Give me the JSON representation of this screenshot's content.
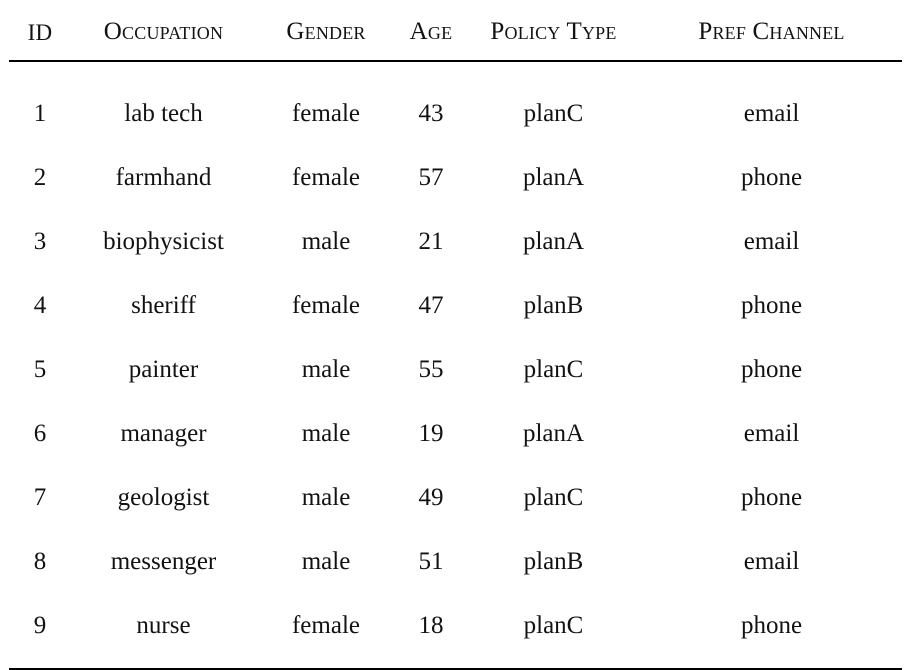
{
  "table": {
    "columns": [
      {
        "key": "id",
        "label": "ID",
        "smallcaps": false
      },
      {
        "key": "occ",
        "label": "Occupation",
        "smallcaps": true
      },
      {
        "key": "gender",
        "label": "Gender",
        "smallcaps": true
      },
      {
        "key": "age",
        "label": "Age",
        "smallcaps": true
      },
      {
        "key": "policy",
        "label": "Policy Type",
        "smallcaps": true
      },
      {
        "key": "channel",
        "label": "Pref Channel",
        "smallcaps": true
      }
    ],
    "rows": [
      {
        "id": "1",
        "occ": "lab tech",
        "gender": "female",
        "age": "43",
        "policy": "planC",
        "channel": "email"
      },
      {
        "id": "2",
        "occ": "farmhand",
        "gender": "female",
        "age": "57",
        "policy": "planA",
        "channel": "phone"
      },
      {
        "id": "3",
        "occ": "biophysicist",
        "gender": "male",
        "age": "21",
        "policy": "planA",
        "channel": "email"
      },
      {
        "id": "4",
        "occ": "sheriff",
        "gender": "female",
        "age": "47",
        "policy": "planB",
        "channel": "phone"
      },
      {
        "id": "5",
        "occ": "painter",
        "gender": "male",
        "age": "55",
        "policy": "planC",
        "channel": "phone"
      },
      {
        "id": "6",
        "occ": "manager",
        "gender": "male",
        "age": "19",
        "policy": "planA",
        "channel": "email"
      },
      {
        "id": "7",
        "occ": "geologist",
        "gender": "male",
        "age": "49",
        "policy": "planC",
        "channel": "phone"
      },
      {
        "id": "8",
        "occ": "messenger",
        "gender": "male",
        "age": "51",
        "policy": "planB",
        "channel": "email"
      },
      {
        "id": "9",
        "occ": "nurse",
        "gender": "female",
        "age": "18",
        "policy": "planC",
        "channel": "phone"
      }
    ],
    "colors": {
      "text": "#121212",
      "rule": "#000000",
      "background": "#ffffff"
    }
  }
}
